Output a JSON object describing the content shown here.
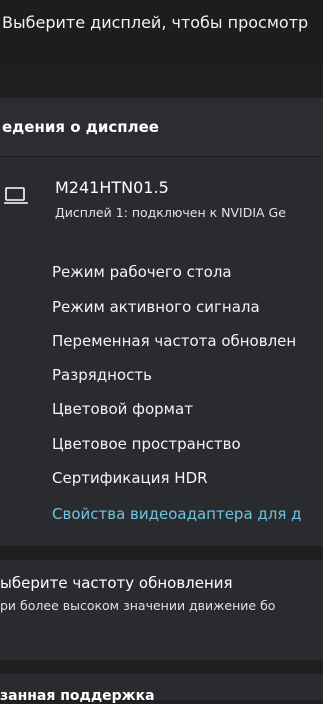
{
  "top_text": "Выберите дисплей, чтобы просмотр",
  "display_info": {
    "header": "едения о дисплее",
    "name": "M241HTN01.5",
    "subtitle": "Дисплей 1: подключен к NVIDIA Ge",
    "items": [
      "Режим рабочего стола",
      "Режим активного сигнала",
      "Переменная частота обновлен",
      "Разрядность",
      "Цветовой формат",
      "Цветовое пространство",
      "Сертификация HDR"
    ],
    "link": "Свойства видеоадаптера для д"
  },
  "refresh": {
    "title": "ыберите частоту обновления",
    "description": "ри более высоком значении движение бо"
  },
  "support": {
    "title": "занная поддержка"
  },
  "colors": {
    "link": "#6fc3e0",
    "background": "#1f2022",
    "card": "#2a2b2e"
  },
  "icons": {
    "monitor": "monitor-icon"
  }
}
